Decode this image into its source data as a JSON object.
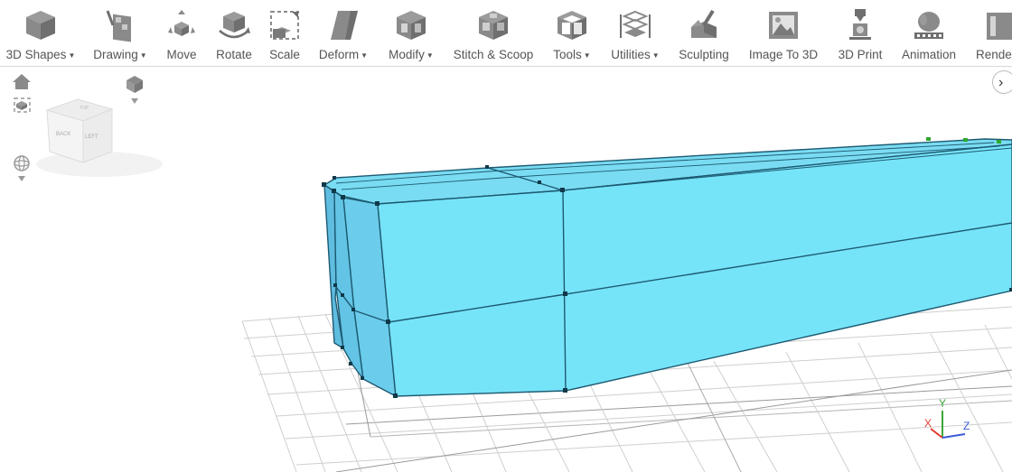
{
  "toolbar": {
    "items": [
      {
        "label": "3D Shapes",
        "dropdown": true,
        "icon": "cube-icon"
      },
      {
        "label": "Drawing",
        "dropdown": true,
        "icon": "drawing-icon"
      },
      {
        "label": "Move",
        "dropdown": false,
        "icon": "move-icon"
      },
      {
        "label": "Rotate",
        "dropdown": false,
        "icon": "rotate-icon"
      },
      {
        "label": "Scale",
        "dropdown": false,
        "icon": "scale-icon"
      },
      {
        "label": "Deform",
        "dropdown": true,
        "icon": "deform-icon"
      },
      {
        "label": "Modify",
        "dropdown": true,
        "icon": "modify-icon"
      },
      {
        "label": "Stitch & Scoop",
        "dropdown": false,
        "icon": "stitch-scoop-icon"
      },
      {
        "label": "Tools",
        "dropdown": true,
        "icon": "tools-icon"
      },
      {
        "label": "Utilities",
        "dropdown": true,
        "icon": "utilities-icon"
      },
      {
        "label": "Sculpting",
        "dropdown": false,
        "icon": "sculpting-icon"
      },
      {
        "label": "Image To 3D",
        "dropdown": false,
        "icon": "image-to-3d-icon"
      },
      {
        "label": "3D Print",
        "dropdown": false,
        "icon": "3d-print-icon"
      },
      {
        "label": "Animation",
        "dropdown": false,
        "icon": "animation-icon"
      },
      {
        "label": "Rende",
        "dropdown": false,
        "icon": "render-icon"
      }
    ]
  },
  "view_cube": {
    "front_face": "LEFT",
    "side_face": "BACK",
    "top_face": "TOP"
  },
  "axis_gizmo": {
    "x": "X",
    "y": "Y",
    "z": "Z"
  },
  "colors": {
    "object_fill": "#76e4f8",
    "object_side": "#5fc3e6",
    "object_edge": "#1d5a72",
    "grid": "#cfcfcf",
    "axis_x": "#e03a2f",
    "axis_y": "#3aa63a",
    "axis_z": "#3b5bd6"
  }
}
